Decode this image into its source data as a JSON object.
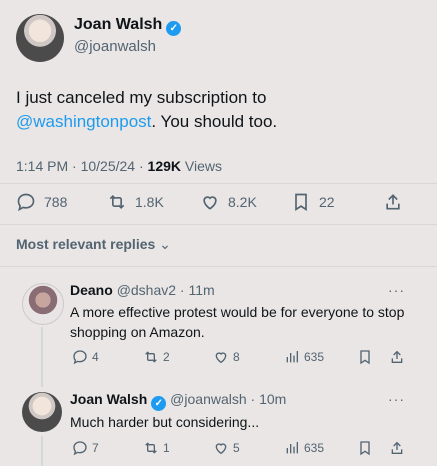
{
  "main_tweet": {
    "display_name": "Joan Walsh",
    "handle": "@joanwalsh",
    "text_prefix": "I just canceled my subscription to",
    "mention": "@washingtonpost",
    "text_suffix": ". You should too.",
    "timestamp": "1:14 PM · 10/25/24 · ",
    "views_count": "129K",
    "views_label": " Views",
    "replies": "788",
    "reposts": "1.8K",
    "likes": "8.2K",
    "bookmarks": "22"
  },
  "sort": {
    "label": "Most relevant replies"
  },
  "replies": [
    {
      "display_name": "Deano",
      "handle_time": "@dshav2 · 11m",
      "text": "A more effective protest would be for everyone to stop shopping on Amazon.",
      "replies": "4",
      "reposts": "2",
      "likes": "8",
      "views": "635"
    },
    {
      "display_name": "Joan Walsh",
      "handle_time": "@joanwalsh · 10m",
      "text": "Much harder but considering...",
      "replies": "7",
      "reposts": "1",
      "likes": "5",
      "views": "635"
    }
  ],
  "more_glyph": "···"
}
